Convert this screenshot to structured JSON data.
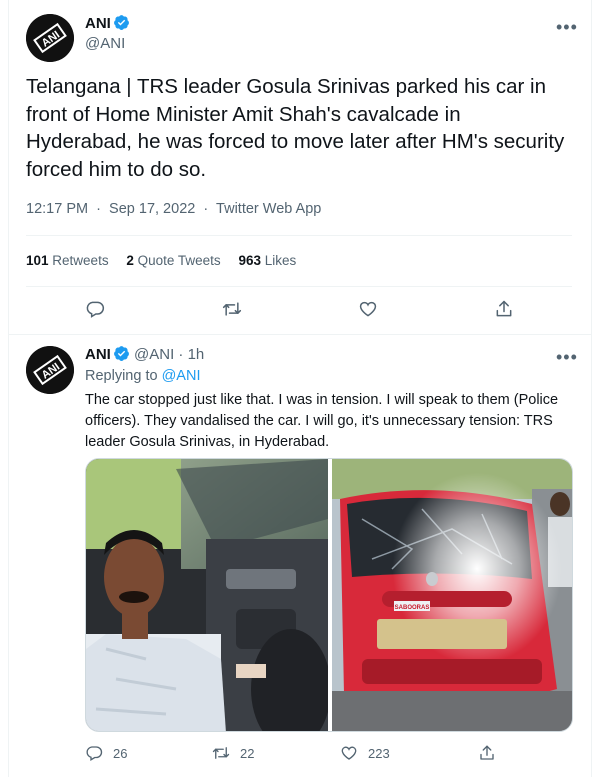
{
  "main_tweet": {
    "author_name": "ANI",
    "author_handle": "@ANI",
    "text": "Telangana | TRS leader Gosula Srinivas parked his car in front of Home Minister Amit Shah's cavalcade in Hyderabad, he was forced to move later after HM's security forced him to do so.",
    "time": "12:17 PM",
    "date": "Sep 17, 2022",
    "source": "Twitter Web App",
    "separator": "·",
    "stats": [
      {
        "count": "101",
        "label": "Retweets"
      },
      {
        "count": "2",
        "label": "Quote Tweets"
      },
      {
        "count": "963",
        "label": "Likes"
      }
    ],
    "actions": [
      "reply-icon",
      "retweet-icon",
      "like-icon",
      "share-icon"
    ]
  },
  "reply_tweet": {
    "author_name": "ANI",
    "author_handle": "@ANI",
    "age": "· 1h",
    "replying_prefix": "Replying to",
    "replying_to": "@ANI",
    "text": "The car stopped just like that. I was in tension. I will speak to them (Police officers). They vandalised the car. I will go, it's unnecessary tension: TRS leader Gosula Srinivas, in Hyderabad.",
    "plate_text": "SABOORAS",
    "reply_count": "26",
    "retweet_count": "22",
    "like_count": "223"
  },
  "colors": {
    "verified": "#1d9bf0",
    "text_primary": "#0f1419",
    "text_secondary": "#536471",
    "link": "#1d9bf0",
    "border": "#eff3f4",
    "car_red": "#d8293a"
  },
  "more_icon": "more-dots-icon",
  "avatar_logo_text": "ANI"
}
